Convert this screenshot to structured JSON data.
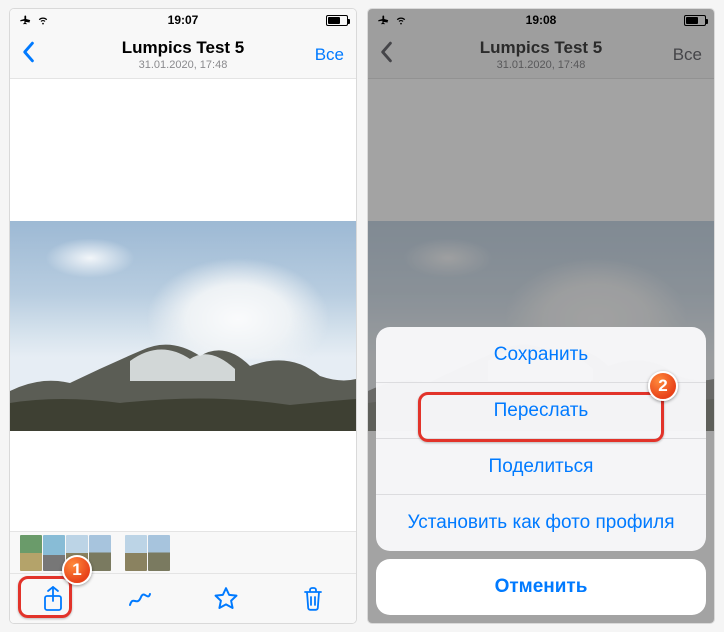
{
  "status": {
    "time": "19:07",
    "time_right": "19:08"
  },
  "nav": {
    "title": "Lumpics Test 5",
    "subtitle": "31.01.2020, 17:48",
    "all_button": "Все"
  },
  "action_sheet": {
    "items": [
      {
        "label": "Сохранить"
      },
      {
        "label": "Переслать"
      },
      {
        "label": "Поделиться"
      },
      {
        "label": "Установить как фото профиля"
      }
    ],
    "cancel": "Отменить"
  },
  "annotations": {
    "badge1": "1",
    "badge2": "2"
  }
}
